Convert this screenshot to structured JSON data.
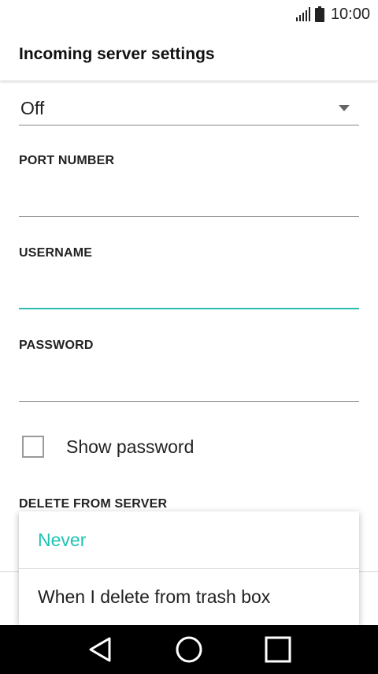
{
  "status_bar": {
    "time": "10:00",
    "signal_icon": "signal-icon",
    "battery_icon": "battery-icon"
  },
  "header": {
    "title": "Incoming server settings"
  },
  "security": {
    "selected_value": "Off",
    "arrow_icon": "dropdown-arrow-icon"
  },
  "port": {
    "label": "PORT NUMBER",
    "value": ""
  },
  "username": {
    "label": "USERNAME",
    "value": ""
  },
  "password": {
    "label": "PASSWORD",
    "value": ""
  },
  "show_password": {
    "label": "Show password",
    "checked": false
  },
  "delete_from_server": {
    "label": "DELETE FROM SERVER",
    "options": [
      {
        "label": "Never",
        "selected": true
      },
      {
        "label": "When I delete from trash box",
        "selected": false
      }
    ]
  },
  "colors": {
    "accent": "#1fc4b4",
    "nav_bar": "#000000"
  },
  "nav": {
    "back_icon": "back-icon",
    "home_icon": "home-icon",
    "recents_icon": "recents-icon"
  }
}
